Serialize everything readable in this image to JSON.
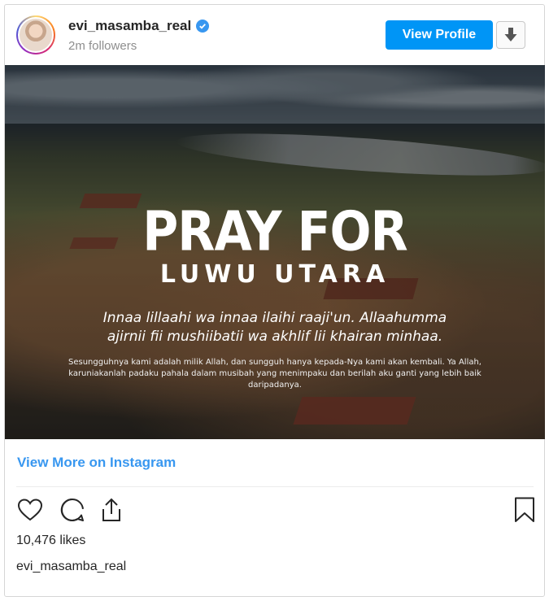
{
  "header": {
    "username": "evi_masamba_real",
    "followers": "2m followers",
    "view_profile_label": "View Profile",
    "verified_icon": "verified-badge-icon",
    "download_icon": "download-icon"
  },
  "post": {
    "title_line1": "PRAY FOR",
    "title_line2": "LUWU UTARA",
    "arabic_prayer": "Innaa lillaahi wa innaa ilaihi raaji'un. Allaahumma ajirnii fii mushiibatii wa akhlif lii khairan minhaa.",
    "translation": "Sesungguhnya kami adalah milik Allah, dan sungguh hanya kepada-Nya kami akan kembali. Ya Allah, karuniakanlah padaku pahala dalam musibah yang menimpaku dan berilah aku ganti yang lebih baik daripadanya."
  },
  "footer": {
    "view_more_label": "View More on Instagram",
    "likes": "10,476 likes",
    "caption_username": "evi_masamba_real",
    "icons": [
      "heart-icon",
      "comment-icon",
      "share-icon",
      "bookmark-icon"
    ]
  },
  "colors": {
    "brand_blue": "#0095f6",
    "link_blue": "#3897f0",
    "text": "#262626",
    "muted": "#8e8e8e"
  }
}
